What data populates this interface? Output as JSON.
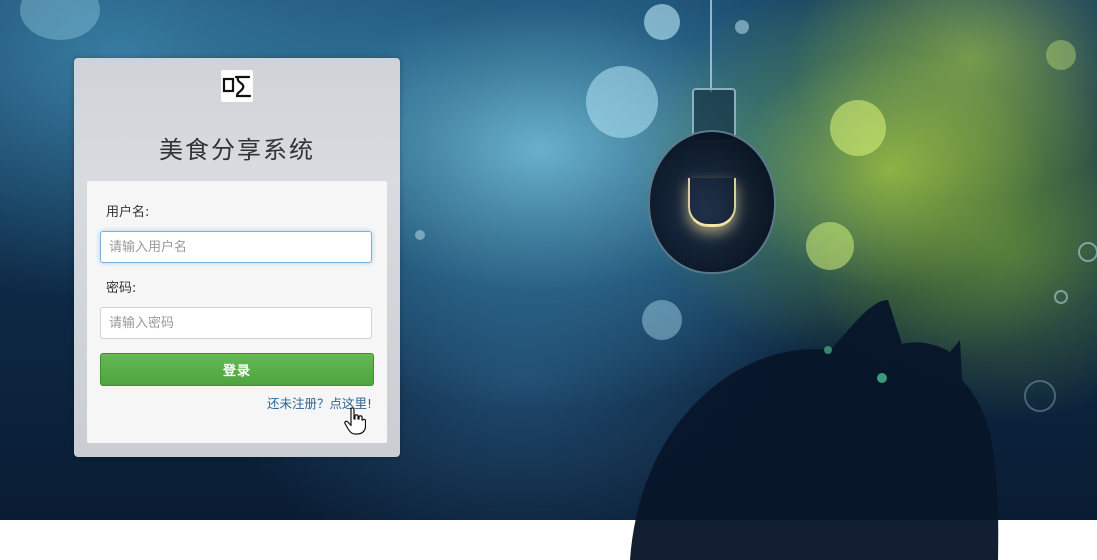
{
  "app": {
    "title": "美食分享系统",
    "logo_text": "吃"
  },
  "form": {
    "username_label": "用户名:",
    "username_placeholder": "请输入用户名",
    "username_value": "",
    "password_label": "密码:",
    "password_placeholder": "请输入密码",
    "password_value": "",
    "login_button": "登录",
    "register_link": "还未注册？点这里!"
  },
  "cursor": {
    "icon": "hand-pointer-icon"
  },
  "colors": {
    "login_button": "#55aa44",
    "link": "#2a6496",
    "focus_border": "#7fb1d8"
  }
}
